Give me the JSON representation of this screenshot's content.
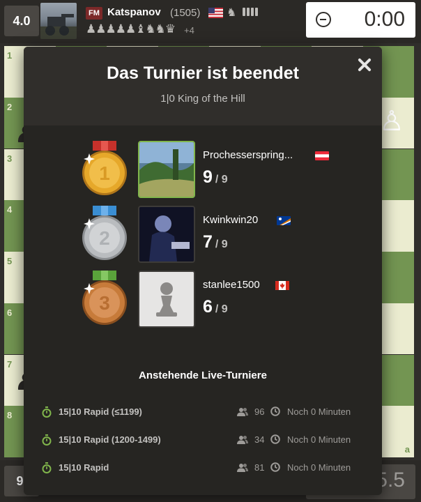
{
  "top_player": {
    "score": "4.0",
    "title": "FM",
    "name": "Katspanov",
    "rating": "(1505)",
    "flag_icon": "usa-flag-icon",
    "captured_pieces": "♟♟♟♟♟♝♞♞♛",
    "extra_material": "+4",
    "clock": "0:00"
  },
  "bottom_player": {
    "score": "9.",
    "clock": "5.5"
  },
  "board": {
    "light_color": "#ebecd0",
    "dark_color": "#739552",
    "rank_labels": [
      "1",
      "2",
      "3",
      "4",
      "5",
      "6",
      "7",
      "8"
    ],
    "file_label": "a"
  },
  "modal": {
    "title": "Das Turnier ist beendet",
    "subtitle": "1|0 King of the Hill",
    "podium": [
      {
        "place": "1",
        "name": "Prochesserspring...",
        "flag_icon": "austria-flag-icon",
        "score": "9",
        "total": "/ 9"
      },
      {
        "place": "2",
        "name": "Kwinkwin20",
        "flag_icon": "marshall-islands-flag-icon",
        "score": "7",
        "total": "/ 9"
      },
      {
        "place": "3",
        "name": "stanlee1500",
        "flag_icon": "canada-flag-icon",
        "score": "6",
        "total": "/ 9"
      }
    ],
    "upcoming_title": "Anstehende Live-Turniere",
    "tournaments": [
      {
        "name": "15|10 Rapid (≤1199)",
        "players": "96",
        "time_left": "Noch 0 Minuten"
      },
      {
        "name": "15|10 Rapid (1200-1499)",
        "players": "34",
        "time_left": "Noch 0 Minuten"
      },
      {
        "name": "15|10 Rapid",
        "players": "81",
        "time_left": "Noch 0 Minuten"
      }
    ]
  },
  "colors": {
    "rapid_green": "#81b64c",
    "gold": "#e6a82a",
    "silver": "#b9bcbf",
    "bronze": "#c77b3a"
  }
}
